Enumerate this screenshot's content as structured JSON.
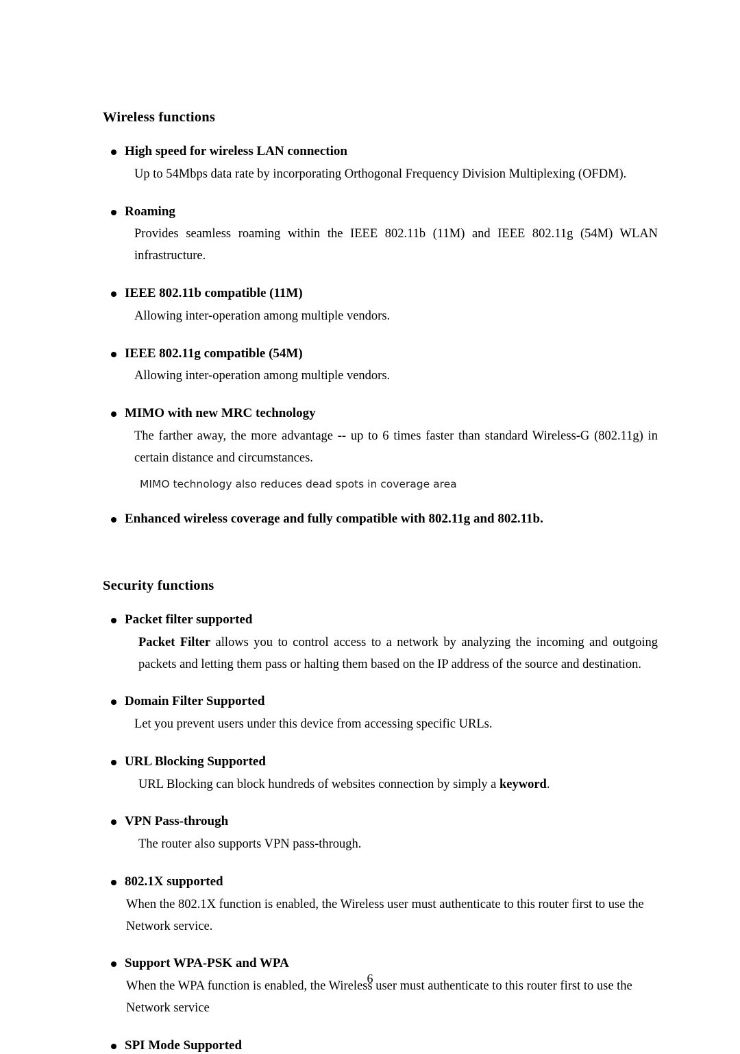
{
  "document": {
    "page_number": "6",
    "sections": [
      {
        "id": "wireless",
        "heading": "Wireless functions",
        "items": [
          {
            "title": "High speed for wireless LAN connection",
            "body": "Up to 54Mbps data rate by incorporating Orthogonal Frequency Division Multiplexing (OFDM)."
          },
          {
            "title": "Roaming",
            "body": "Provides seamless roaming within the IEEE 802.11b (11M) and IEEE 802.11g (54M) WLAN infrastructure."
          },
          {
            "title": "IEEE 802.11b compatible (11M)",
            "body": "Allowing inter-operation among multiple vendors."
          },
          {
            "title": "IEEE 802.11g compatible (54M)",
            "body": "Allowing inter-operation among multiple vendors."
          },
          {
            "title": "MIMO with new MRC technology",
            "body": "The farther away, the more advantage -- up to 6 times faster than standard Wireless-G (802.11g) in certain distance and circumstances.",
            "note": "MIMO technology also reduces dead spots in coverage area"
          },
          {
            "title": "Enhanced wireless coverage and fully compatible with 802.11g and 802.11b.",
            "body": ""
          }
        ]
      },
      {
        "id": "security",
        "heading": "Security functions",
        "items": [
          {
            "title": "Packet filter supported",
            "body_lead": "Packet Filter",
            "body_rest": " allows you to control access to a network by analyzing the incoming and outgoing packets and letting them pass or halting them based on the IP address of the source and destination."
          },
          {
            "title": "Domain Filter Supported",
            "body": "Let you prevent users under this device from accessing specific URLs."
          },
          {
            "title": "URL Blocking Supported",
            "body_pre": "URL Blocking can block hundreds of websites connection by simply a ",
            "body_bold": "keyword",
            "body_post": "."
          },
          {
            "title": "VPN Pass-through",
            "body": "The router also supports VPN pass-through."
          },
          {
            "title": "802.1X supported",
            "body": "When the 802.1X function is enabled, the Wireless user must authenticate to this router first to use the Network service."
          },
          {
            "title": "Support WPA-PSK and WPA",
            "body": "When the WPA function is enabled, the Wireless user must authenticate to this router first to use the Network service"
          },
          {
            "title": "SPI Mode Supported",
            "body": ""
          }
        ]
      }
    ]
  }
}
